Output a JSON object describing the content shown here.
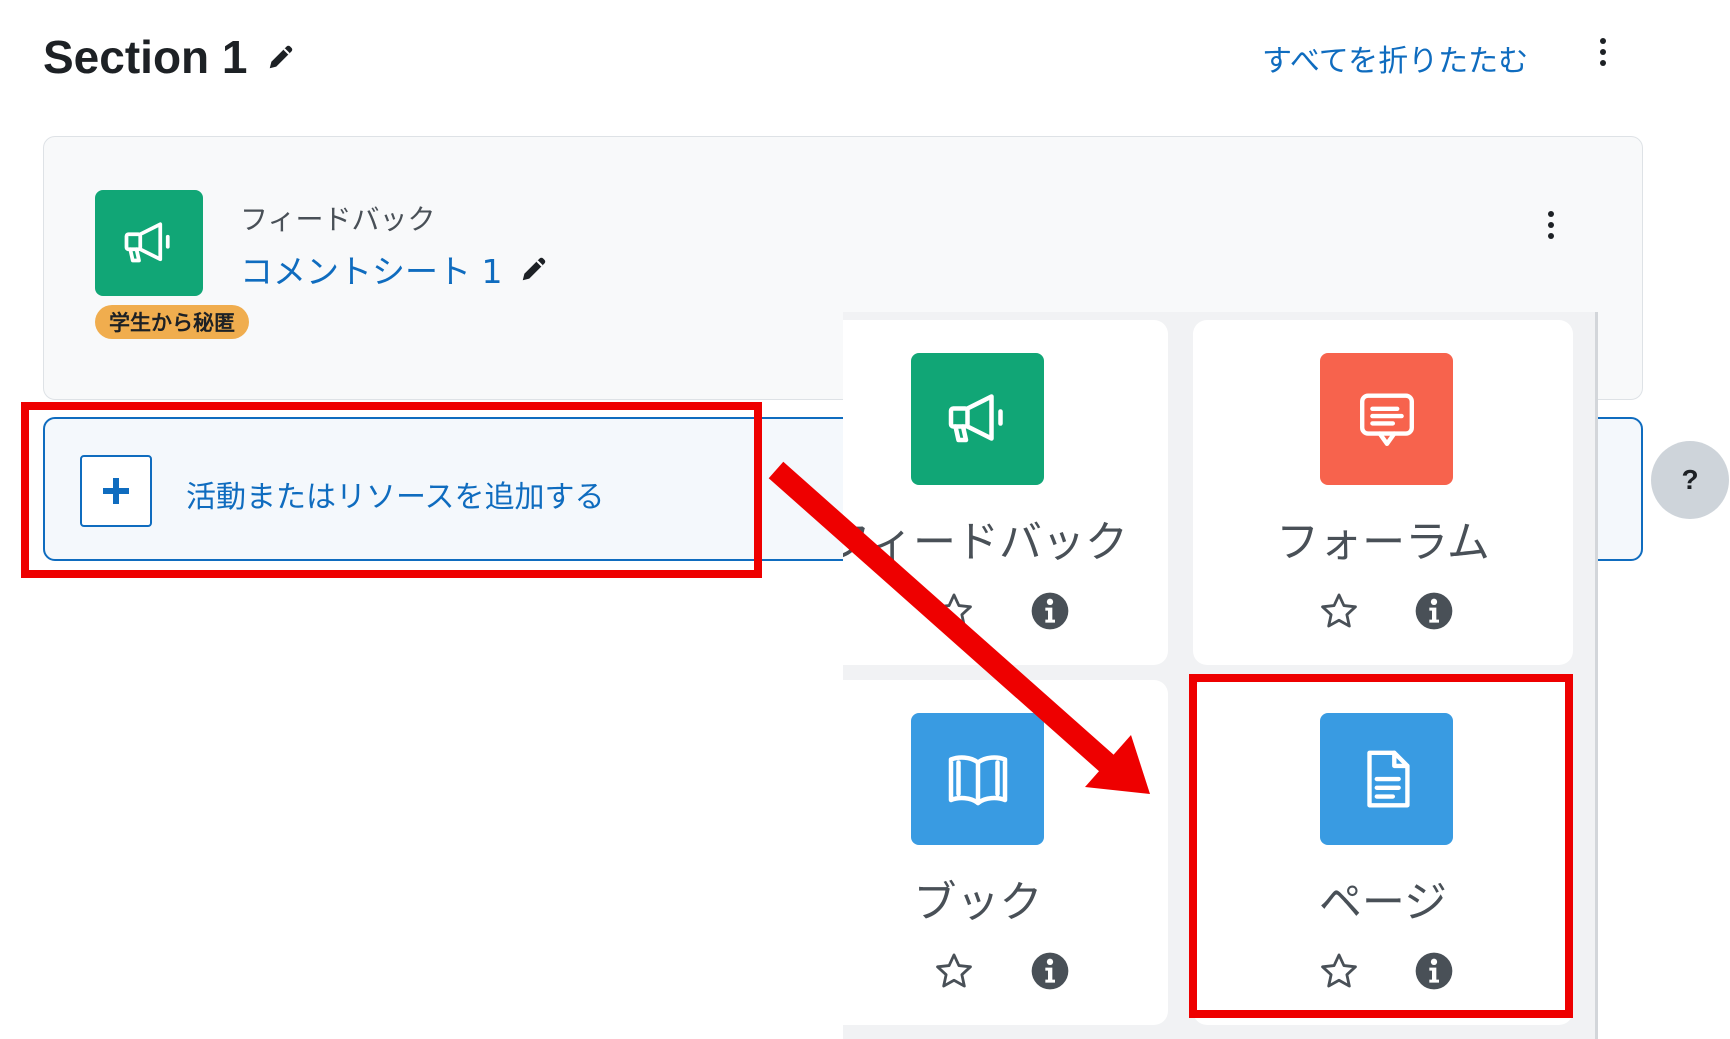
{
  "section": {
    "title": "Section 1",
    "collapse_all": "すべてを折りたたむ"
  },
  "activity": {
    "type_label": "フィードバック",
    "name": "コメントシート 1",
    "badge": "学生から秘匿"
  },
  "add_activity": {
    "label": "活動またはリソースを追加する"
  },
  "help": {
    "label": "?"
  },
  "chooser": {
    "tiles": [
      {
        "label": "フィードバック",
        "icon": "megaphone-icon",
        "color": "#11a676"
      },
      {
        "label": "フォーラム",
        "icon": "forum-icon",
        "color": "#f7634d"
      },
      {
        "label": "ブック",
        "icon": "book-icon",
        "color": "#399be2"
      },
      {
        "label": "ページ",
        "icon": "page-icon",
        "color": "#399be2"
      }
    ]
  },
  "colors": {
    "link": "#0f6cbf",
    "annotation": "#ee0000",
    "hidden_badge": "#f0ad4e"
  }
}
